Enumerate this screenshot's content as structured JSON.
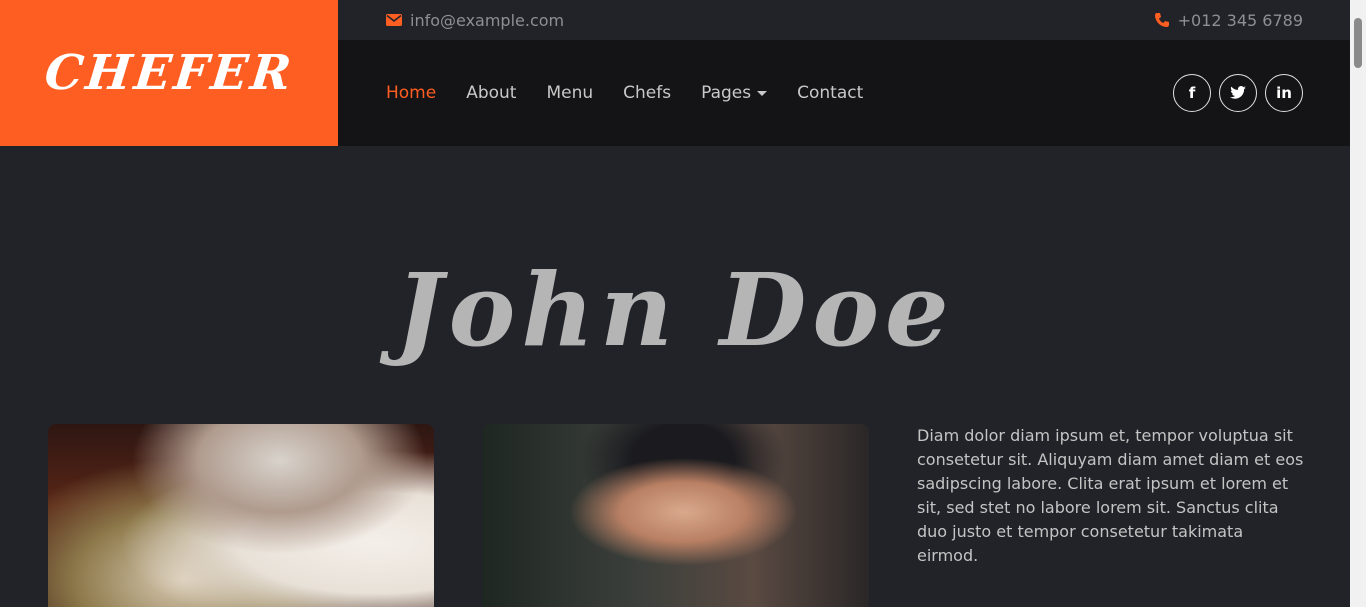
{
  "brand": {
    "name": "CHEFER",
    "color": "#ff5e22"
  },
  "topbar": {
    "email": "info@example.com",
    "email_icon": "envelope-icon",
    "phone": "+012 345 6789",
    "phone_icon": "phone-icon"
  },
  "nav": {
    "items": [
      {
        "label": "Home",
        "active": true
      },
      {
        "label": "About"
      },
      {
        "label": "Menu"
      },
      {
        "label": "Chefs"
      },
      {
        "label": "Pages",
        "dropdown": true
      },
      {
        "label": "Contact"
      }
    ]
  },
  "socials": [
    {
      "icon": "facebook-icon",
      "glyph": "f"
    },
    {
      "icon": "twitter-icon",
      "glyph": "t"
    },
    {
      "icon": "linkedin-icon",
      "glyph": "in"
    }
  ],
  "hero": {
    "title": "John Doe"
  },
  "bio": {
    "text": "Diam dolor diam ipsum et, tempor voluptua sit consetetur sit. Aliquyam diam amet diam et eos sadipscing labore. Clita erat ipsum et lorem et sit, sed stet no labore lorem sit. Sanctus clita duo justo et tempor consetetur takimata eirmod."
  },
  "colors": {
    "accent": "#ff5e22",
    "background": "#222329",
    "navbar": "#141416"
  }
}
